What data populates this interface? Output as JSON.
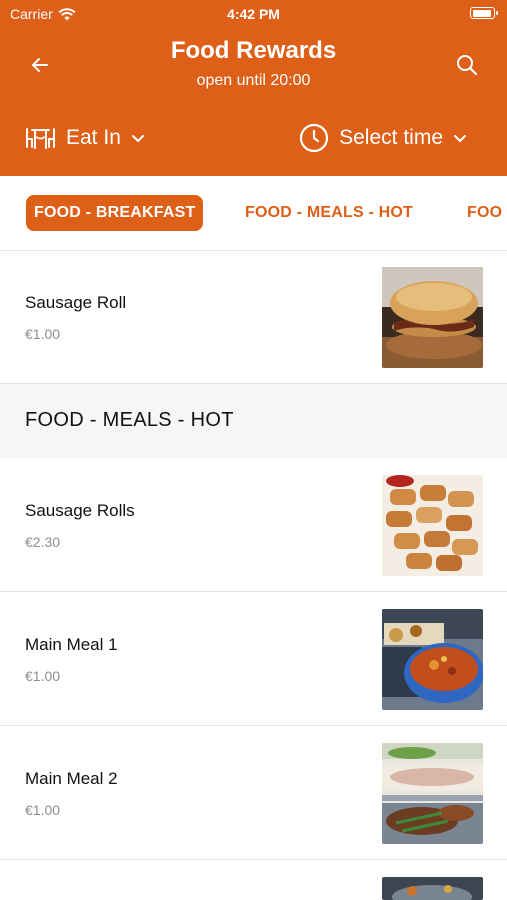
{
  "status_bar": {
    "carrier": "Carrier",
    "time": "4:42 PM",
    "battery_level": 0.95
  },
  "header": {
    "title": "Food Rewards",
    "subtitle": "open until 20:00",
    "back_icon": "back-arrow-icon",
    "search_icon": "search-icon",
    "order_mode_label": "Eat In",
    "order_mode_icon": "dining-table-icon",
    "time_label": "Select time",
    "time_icon": "clock-icon"
  },
  "tabs": [
    {
      "label": "FOOD - BREAKFAST",
      "active": true
    },
    {
      "label": "FOOD - MEALS - HOT",
      "active": false
    },
    {
      "label": "FOO",
      "active": false
    }
  ],
  "menu": {
    "breakfast_items": [
      {
        "name": "Sausage Roll",
        "price": "€1.00",
        "image": "burger-photo"
      }
    ],
    "hot_section_title": "FOOD - MEALS - HOT",
    "hot_items": [
      {
        "name": "Sausage Rolls",
        "price": "€2.30",
        "image": "sausage-rolls-photo"
      },
      {
        "name": "Main Meal 1",
        "price": "€1.00",
        "image": "casserole-photo"
      },
      {
        "name": "Main Meal 2",
        "price": "€1.00",
        "image": "buffet-photo"
      }
    ]
  },
  "colors": {
    "brand": "#dd5f18",
    "price_gray": "#8e8e8e",
    "section_bg": "#f6f6f6"
  }
}
